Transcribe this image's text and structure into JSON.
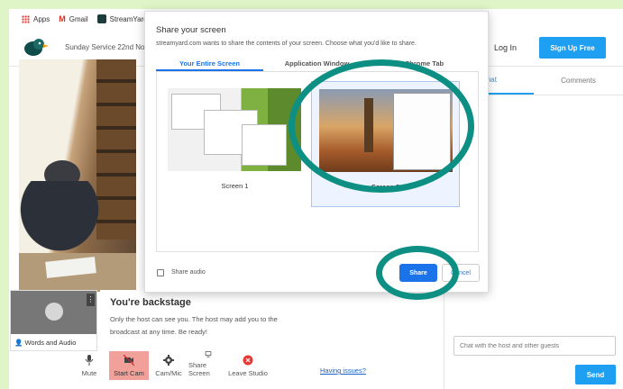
{
  "bookmarks": [
    {
      "label": "Apps",
      "icon": "apps-grid-icon"
    },
    {
      "label": "Gmail",
      "icon": "gmail-icon"
    },
    {
      "label": "StreamYard",
      "icon": "streamyard-icon"
    }
  ],
  "header": {
    "broadcast_title": "Sunday Service 22nd No",
    "login_label": "Log In",
    "signup_label": "Sign Up Free"
  },
  "chat": {
    "tabs": [
      "Chat",
      "Comments"
    ],
    "input_placeholder": "Chat with the host and other guests",
    "send_label": "Send"
  },
  "guest": {
    "name": "Words and Audio",
    "menu_icon": "more-vertical-icon"
  },
  "backstage": {
    "title": "You're backstage",
    "message": "Only the host can see you. The host may add you to the broadcast at any time. Be ready!"
  },
  "controls": [
    {
      "label": "Mute",
      "icon": "microphone-icon"
    },
    {
      "label": "Start Cam",
      "icon": "camera-off-icon",
      "active": true
    },
    {
      "label": "Cam/Mic",
      "icon": "gear-icon"
    },
    {
      "label": "Share Screen",
      "icon": "monitor-icon"
    },
    {
      "label": "Leave Studio",
      "icon": "leave-icon"
    }
  ],
  "having_issues": "Having issues?",
  "dialog": {
    "title": "Share your screen",
    "subtitle": "streamyard.com wants to share the contents of your screen. Choose what you'd like to share.",
    "tabs": [
      "Your Entire Screen",
      "Application Window",
      "Chrome Tab"
    ],
    "screens": [
      "Screen 1",
      "Screen 2"
    ],
    "selected_screen": "Screen 2",
    "share_audio_label": "Share audio",
    "share_label": "Share",
    "cancel_label": "Cancel"
  },
  "colors": {
    "accent": "#1e9ff2",
    "dialog_accent": "#1a73e8",
    "annotation_ring": "#0d8f83",
    "active_control": "#f2a09a"
  }
}
